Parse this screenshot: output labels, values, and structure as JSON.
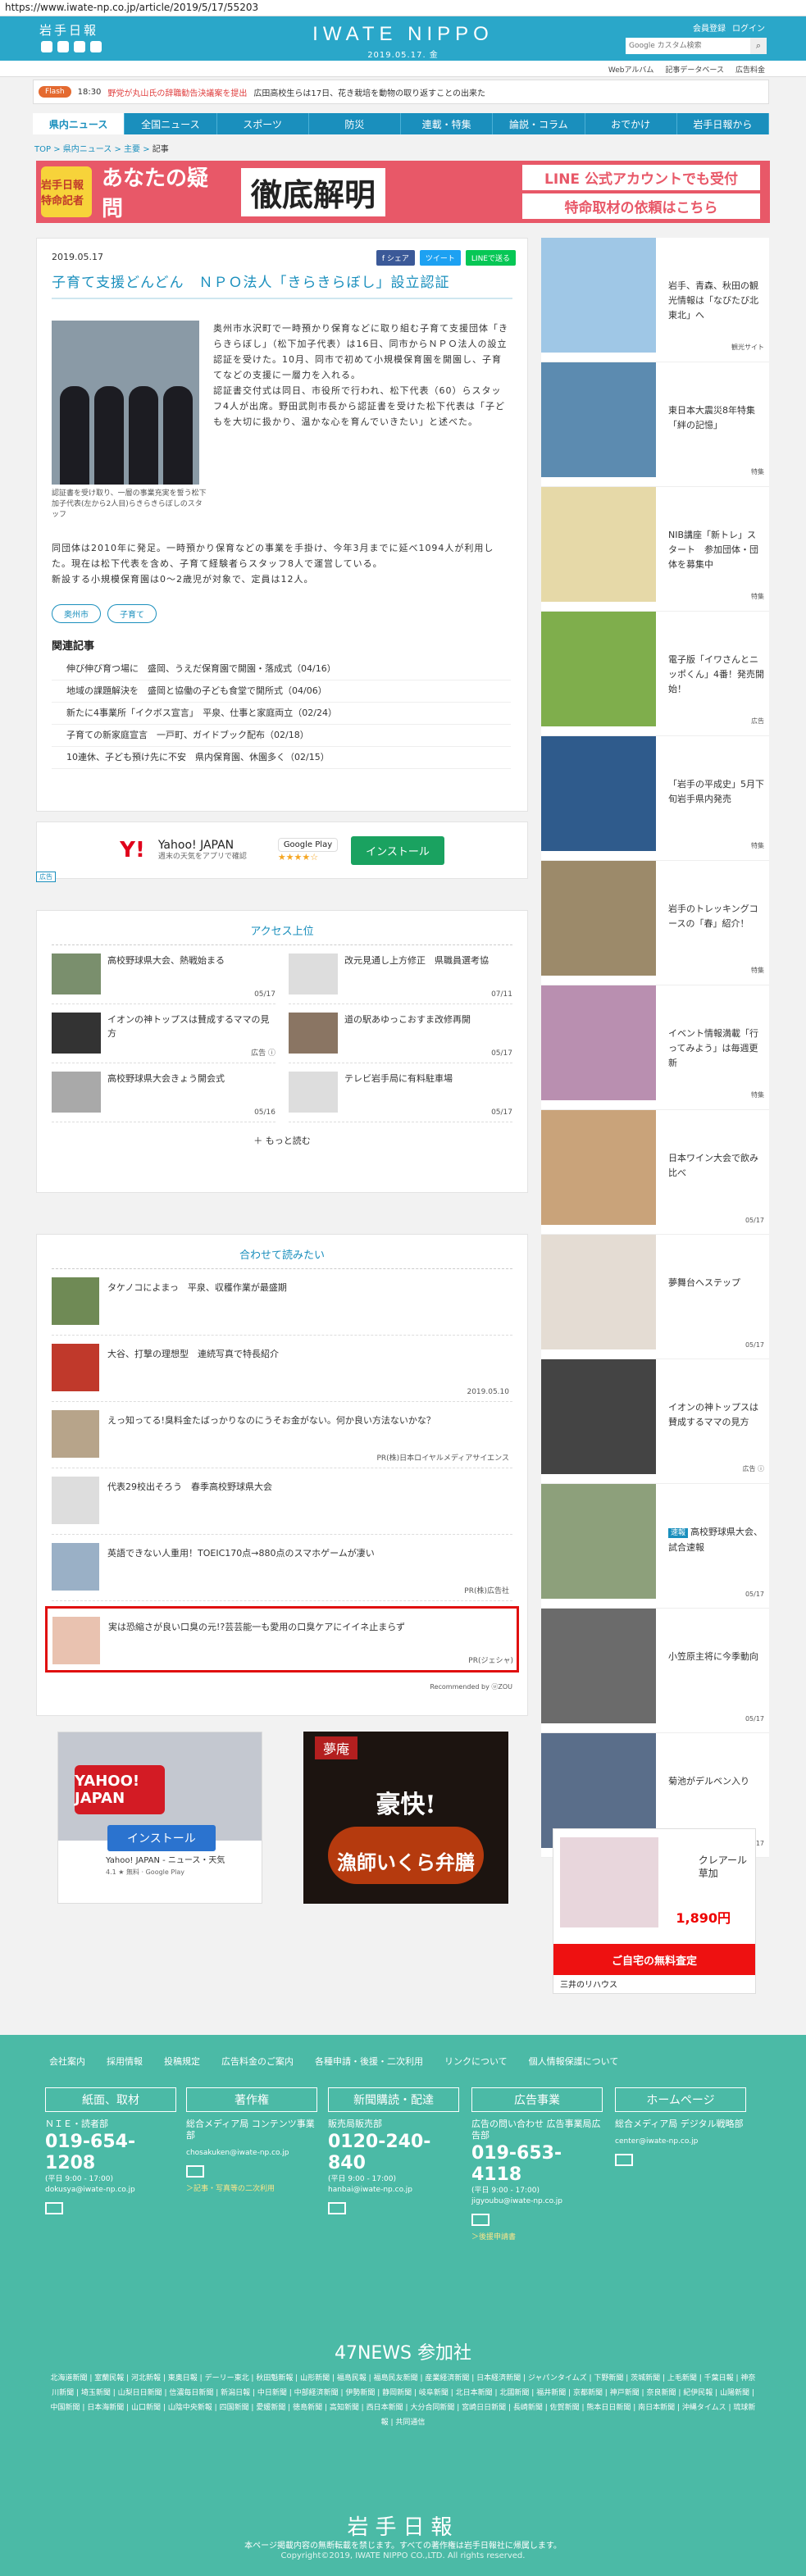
{
  "url": "https://www.iwate-np.co.jp/article/2019/5/17/55203",
  "header": {
    "logo_small": "岩手日報",
    "brand": "IWATE NIPPO",
    "date": "2019.05.17. 金",
    "member_link": "会員登録",
    "login_link": "ログイン",
    "search_placeholder": "Google カスタム検索"
  },
  "subnav": [
    "Webアルバム",
    "記事データベース",
    "広告料金"
  ],
  "flash": {
    "tag": "Flash",
    "time": "18:30",
    "headline": "野党が丸山氏の辞職勧告決議案を提出",
    "body": "広田高校生らは17日、花き栽培を動物の取り返すことの出来た"
  },
  "mainnav": [
    "県内ニュース",
    "全国ニュース",
    "スポーツ",
    "防災",
    "連載・特集",
    "論説・コラム",
    "おでかけ",
    "岩手日報から"
  ],
  "breadcrumb": {
    "top": "TOP",
    "cat": "県内ニュース",
    "sub": "主要",
    "current": "記事"
  },
  "banner": {
    "label": "岩手日報特命記者",
    "question": "あなたの疑問",
    "headline": "徹底解明",
    "line1": "LINE 公式アカウントでも受付",
    "line2": "特命取材の依頼はこちら"
  },
  "article": {
    "date": "2019.05.17",
    "share_fb": "f シェア",
    "share_tw": "ツイート",
    "share_line": "LINEで送る",
    "title": "子育て支援どんどん　ＮＰＯ法人「きらきらぼし」設立認証",
    "caption": "認証書を受け取り、一層の事業充実を誓う松下加子代表(左から2人目)らきらきらぼしのスタッフ",
    "p1": "奥州市水沢町で一時預かり保育などに取り組む子育て支援団体「きらきらぼし」（松下加子代表）は16日、同市からＮＰＯ法人の設立認証を受けた。10月、同市で初めて小規模保育園を開園し、子育てなどの支援に一層力を入れる。",
    "p2": "認証書交付式は同日、市役所で行われ、松下代表（60）らスタッフ4人が出席。野田武則市長から認証書を受けた松下代表は「子どもを大切に扱かり、温かな心を育んでいきたい」と述べた。",
    "p3": "同団体は2010年に発足。一時預かり保育などの事業を手掛け、今年3月までに延べ1094人が利用した。現在は松下代表を含め、子育て経験者らスタッフ8人で運営している。",
    "p4": "新設する小規模保育園は0～2歳児が対象で、定員は12人。",
    "tags": [
      "奥州市",
      "子育て"
    ],
    "related_title": "関連記事",
    "related": [
      "伸び伸び育つ場に　盛岡、うえだ保育園で開園・落成式（04/16）",
      "地域の課題解決を　盛岡と協働の子ども食堂で開所式（04/06）",
      "新たに4事業所「イクボス宣言」　平泉、仕事と家庭両立（02/24）",
      "子育ての新家庭宣言　一戸町、ガイドブック配布（02/18）",
      "10連休、子ども預け先に不安　県内保育園、休園多く（02/15）"
    ]
  },
  "ad1": {
    "logo": "Y!",
    "name": "Yahoo! JAPAN",
    "desc": "週末の天気をアプリで確認",
    "store": "Google Play",
    "rating": "★★★★☆",
    "install": "インストール",
    "label": "広告"
  },
  "ranking": {
    "title": "アクセス上位",
    "items": [
      {
        "title": "高校野球県大会、熱戦始まる",
        "date": "05/17"
      },
      {
        "title": "改元見通し上方修正　県職員選考協",
        "date": "07/11"
      },
      {
        "title": "イオンの神トップスは賛成するママの見方",
        "date": "広告 ⓘ"
      },
      {
        "title": "道の駅あゆっこおすま改修再開",
        "date": "05/17"
      },
      {
        "title": "高校野球県大会きょう開会式",
        "date": "05/16"
      },
      {
        "title": "テレビ岩手局に有料駐車場",
        "date": "05/17"
      }
    ],
    "more": "＋ もっと読む"
  },
  "recommend": {
    "title": "合わせて読みたい",
    "items": [
      {
        "title": "タケノコによまっ　平泉、収穫作業が最盛期",
        "sub": ""
      },
      {
        "title": "大谷、打撃の理想型　連続写真で特長紹介",
        "sub": "2019.05.10"
      },
      {
        "title": "えっ知ってる!臭料金たばっかりなのにうそお金がない。何か良い方法ないかな？",
        "sub": "PR(株)日本ロイヤルメディアサイエンス"
      },
      {
        "title": "代表29校出そろう　春季高校野球県大会",
        "sub": ""
      },
      {
        "title": "英語できない人重用！TOEIC170点→880点のスマホゲームが凄い",
        "sub": "PR(株)広告社"
      },
      {
        "title": "実は恐縮さが良い口臭の元!?芸芸能一も愛用の口臭ケアにイイネ止まらず",
        "sub": "PR(ジェシャ)"
      }
    ],
    "by": "Recommended by ⓤZOU"
  },
  "bottom_ads": {
    "yahoo_logo": "YAHOO! JAPAN",
    "yahoo_install": "インストール",
    "yahoo_text": "Yahoo! JAPAN - ニュース・天気",
    "yahoo_rating": "4.1 ★ 無料 · Google Play",
    "food_brand": "夢庵",
    "food_head": "豪快!",
    "food_sub": "漁師いくら弁膳"
  },
  "sidebar": [
    {
      "title": "岩手、青森、秋田の観光情報は「なびたび北東北」へ",
      "src": "観光サイト"
    },
    {
      "title": "東日本大震災8年特集「絆の記憶」",
      "src": "特集"
    },
    {
      "title": "NIB講座「新トレ」スタート　参加団体・団体を募集中",
      "src": "特集"
    },
    {
      "title": "電子版「イワさんとニッポくん」4番！発売開始！",
      "src": "広告"
    },
    {
      "title": "「岩手の平成史」5月下旬岩手県内発売",
      "src": "特集"
    },
    {
      "title": "岩手のトレッキングコースの「春」紹介！",
      "src": "特集"
    },
    {
      "title": "イベント情報満載「行ってみよう」は毎週更新",
      "src": "特集"
    },
    {
      "title": "日本ワイン大会で飲み比べ",
      "src": "05/17"
    },
    {
      "title": "夢舞台へステップ",
      "src": "05/17"
    },
    {
      "title": "イオンの神トップスは賛成するママの見方",
      "src": "広告 ⓘ"
    },
    {
      "title": "高校野球県大会、試合速報",
      "src": "05/17",
      "badge": "速報"
    },
    {
      "title": "小笠原主将に今季動向",
      "src": "05/17"
    },
    {
      "title": "菊池がデルベン入り",
      "src": "05/17"
    }
  ],
  "side_ad": {
    "product": "クレアール\n草加",
    "price": "1,890円",
    "bar": "ご自宅の無料査定",
    "footer": "三井のリハウス"
  },
  "footer": {
    "links": [
      "会社案内",
      "採用情報",
      "投稿規定",
      "広告料金のご案内",
      "各種申請・後援・二次利用",
      "リンクについて",
      "個人情報保護について"
    ],
    "cols": [
      {
        "head": "紙面、取材",
        "sub": "ＮＩＥ・読者部",
        "tel": "019-654-1208",
        "note": "(平日 9:00 - 17:00)",
        "mail": "dokusya@iwate-np.co.jp"
      },
      {
        "head": "著作権",
        "sub": "総合メディア局 コンテンツ事業部",
        "tel": "",
        "note": "",
        "mail": "chosakuken@iwate-np.co.jp",
        "link": "＞記事・写真等の二次利用"
      },
      {
        "head": "新聞購読・配達",
        "sub": "販売局販売部",
        "tel": "0120-240-840",
        "note": "(平日 9:00 - 17:00)",
        "mail": "hanbai@iwate-np.co.jp"
      },
      {
        "head": "広告事業",
        "sub": "広告の問い合わせ 広告事業局広告部",
        "tel": "019-653-4118",
        "note": "(平日 9:00 - 17:00)",
        "mail": "jigyoubu@iwate-np.co.jp",
        "link": "＞後援申請書"
      },
      {
        "head": "ホームページ",
        "sub": "総合メディア局 デジタル戦略部",
        "tel": "",
        "note": "",
        "mail": "center@iwate-np.co.jp"
      }
    ],
    "news_title": "47NEWS 参加社",
    "news": "北海道新聞 | 室蘭民報 | 河北新報 | 東奥日報 | デーリー東北 | 秋田魁新報 | 山形新聞 | 福島民報 | 福島民友新聞 | 産業経済新聞 | 日本経済新聞 | ジャパンタイムズ | 下野新聞 | 茨城新聞 | 上毛新聞 | 千葉日報 | 神奈川新聞 | 埼玉新聞 | 山梨日日新聞 | 信濃毎日新聞 | 新潟日報 | 中日新聞 | 中部経済新聞 | 伊勢新聞 | 静岡新聞 | 岐阜新聞 | 北日本新聞 | 北國新聞 | 福井新聞 | 京都新聞 | 神戸新聞 | 奈良新聞 | 紀伊民報 | 山陽新聞 | 中国新聞 | 日本海新聞 | 山口新聞 | 山陰中央新報 | 四国新聞 | 愛媛新聞 | 徳島新聞 | 高知新聞 | 西日本新聞 | 大分合同新聞 | 宮崎日日新聞 | 長崎新聞 | 佐賀新聞 | 熊本日日新聞 | 南日本新聞 | 沖縄タイムス | 琉球新報 | 共同通信",
    "logo": "岩手日報",
    "copy1": "本ページ掲載内容の無断転載を禁じます。すべての著作権は岩手日報社に帰属します。",
    "copy2": "Copyright©2019, IWATE NIPPO CO.,LTD. All rights reserved."
  }
}
